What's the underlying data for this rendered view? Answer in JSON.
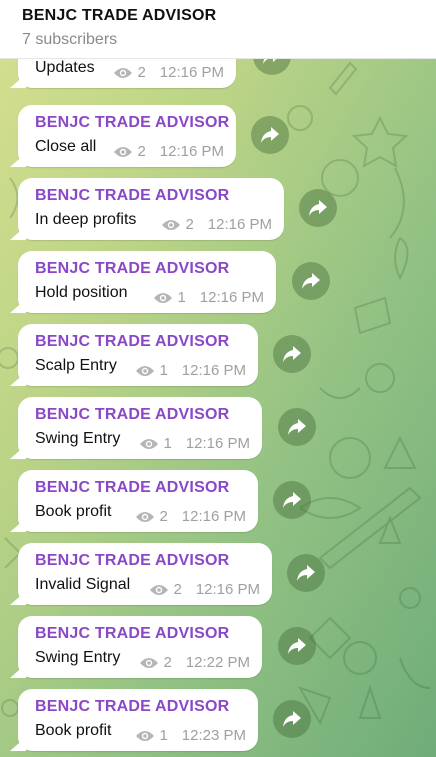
{
  "header": {
    "title": "BENJC TRADE ADVISOR",
    "subtitle": "7 subscribers"
  },
  "messages": [
    {
      "sender": "",
      "text": "Updates",
      "views": "2",
      "time": "12:16 PM"
    },
    {
      "sender": "BENJC TRADE ADVISOR",
      "text": "Close all",
      "views": "2",
      "time": "12:16 PM"
    },
    {
      "sender": "BENJC TRADE ADVISOR",
      "text": "In deep profits",
      "views": "2",
      "time": "12:16 PM"
    },
    {
      "sender": "BENJC TRADE ADVISOR",
      "text": "Hold position",
      "views": "1",
      "time": "12:16 PM"
    },
    {
      "sender": "BENJC TRADE ADVISOR",
      "text": "Scalp Entry",
      "views": "1",
      "time": "12:16 PM"
    },
    {
      "sender": "BENJC TRADE ADVISOR",
      "text": "Swing Entry",
      "views": "1",
      "time": "12:16 PM"
    },
    {
      "sender": "BENJC TRADE ADVISOR",
      "text": "Book profit",
      "views": "2",
      "time": "12:16 PM"
    },
    {
      "sender": "BENJC TRADE ADVISOR",
      "text": "Invalid Signal",
      "views": "2",
      "time": "12:16 PM"
    },
    {
      "sender": "BENJC TRADE ADVISOR",
      "text": "Swing Entry",
      "views": "2",
      "time": "12:22 PM"
    },
    {
      "sender": "BENJC TRADE ADVISOR",
      "text": "Book profit",
      "views": "1",
      "time": "12:23 PM"
    }
  ],
  "colors": {
    "sender_name": "#8a48c7",
    "meta_text": "#a0a0a0",
    "bubble": "#ffffff"
  },
  "icons": {
    "views": "eye-icon",
    "forward": "forward-arrow-icon"
  }
}
